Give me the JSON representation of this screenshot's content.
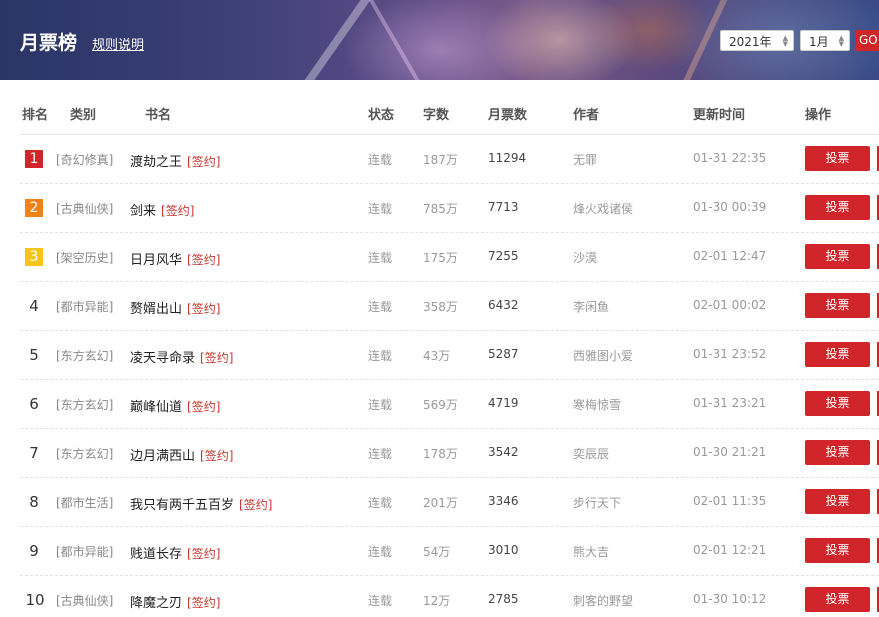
{
  "banner": {
    "title": "月票榜",
    "rules_link": "规则说明",
    "year_select": "2021年",
    "month_select": "1月",
    "go_label": "GO"
  },
  "table": {
    "headers": {
      "rank": "排名",
      "category": "类别",
      "book": "书名",
      "status": "状态",
      "words": "字数",
      "votes": "月票数",
      "author": "作者",
      "updated": "更新时间",
      "action": "操作"
    },
    "sign_tag": "[签约]",
    "vote_label": "投票",
    "rows": [
      {
        "rank": "1",
        "category": "[奇幻修真]",
        "book": "渡劫之王",
        "status": "连载",
        "words": "187万",
        "votes": "11294",
        "author": "无罪",
        "updated": "01-31 22:35"
      },
      {
        "rank": "2",
        "category": "[古典仙侠]",
        "book": "剑来",
        "status": "连载",
        "words": "785万",
        "votes": "7713",
        "author": "烽火戏诸侯",
        "updated": "01-30 00:39"
      },
      {
        "rank": "3",
        "category": "[架空历史]",
        "book": "日月风华",
        "status": "连载",
        "words": "175万",
        "votes": "7255",
        "author": "沙漠",
        "updated": "02-01 12:47"
      },
      {
        "rank": "4",
        "category": "[都市异能]",
        "book": "赘婿出山",
        "status": "连载",
        "words": "358万",
        "votes": "6432",
        "author": "李闲鱼",
        "updated": "02-01 00:02"
      },
      {
        "rank": "5",
        "category": "[东方玄幻]",
        "book": "凌天寻命录",
        "status": "连载",
        "words": "43万",
        "votes": "5287",
        "author": "西雅图小爱",
        "updated": "01-31 23:52"
      },
      {
        "rank": "6",
        "category": "[东方玄幻]",
        "book": "巅峰仙道",
        "status": "连载",
        "words": "569万",
        "votes": "4719",
        "author": "寒梅惊雪",
        "updated": "01-31 23:21"
      },
      {
        "rank": "7",
        "category": "[东方玄幻]",
        "book": "边月满西山",
        "status": "连载",
        "words": "178万",
        "votes": "3542",
        "author": "奕辰辰",
        "updated": "01-30 21:21"
      },
      {
        "rank": "8",
        "category": "[都市生活]",
        "book": "我只有两千五百岁",
        "status": "连载",
        "words": "201万",
        "votes": "3346",
        "author": "步行天下",
        "updated": "02-01 11:35"
      },
      {
        "rank": "9",
        "category": "[都市异能]",
        "book": "贱道长存",
        "status": "连载",
        "words": "54万",
        "votes": "3010",
        "author": "熊大吉",
        "updated": "02-01 12:21"
      },
      {
        "rank": "10",
        "category": "[古典仙侠]",
        "book": "降魔之刃",
        "status": "连载",
        "words": "12万",
        "votes": "2785",
        "author": "刺客的野望",
        "updated": "01-30 10:12"
      }
    ]
  },
  "colors": {
    "accent": "#d0252a",
    "rank1": "#d0252a",
    "rank2": "#f08318",
    "rank3": "#f5c518"
  }
}
